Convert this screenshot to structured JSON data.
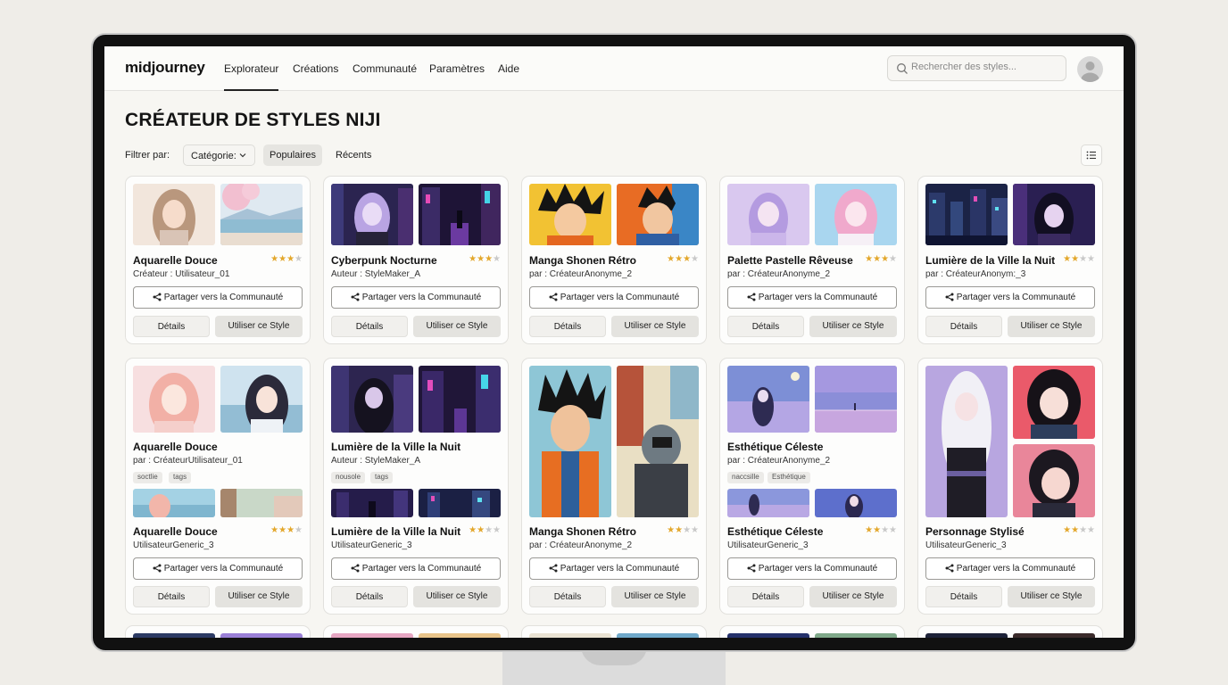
{
  "nav": {
    "logo": "midjourney",
    "items": [
      "Explorateur",
      "Créations",
      "Communauté",
      "Paramètres",
      "Aide"
    ],
    "search_placeholder": "Rechercher des styles..."
  },
  "page": {
    "title": "CRÉATEUR DE STYLES NIJI",
    "filter_label": "Filtrer par:",
    "category_label": "Catégorie:",
    "filters": [
      "Populaires",
      "Récents"
    ]
  },
  "buttons": {
    "share": "Partager vers la Communauté",
    "details": "Détails",
    "use": "Utiliser ce Style"
  },
  "row1": [
    {
      "title": "Aquarelle Douce",
      "author": "Créateur : Utilisateur_01",
      "rating": 3
    },
    {
      "title": "Cyberpunk Nocturne",
      "author": "Auteur : StyleMaker_A",
      "rating": 3
    },
    {
      "title": "Manga Shonen Rétro",
      "author": "par : CréateurAnonyme_2",
      "rating": 3
    },
    {
      "title": "Palette Pastelle Rêveuse",
      "author": "par : CréateurAnonyme_2",
      "rating": 3
    },
    {
      "title": "Lumière de la Ville la Nuit",
      "author": "par : CréateurAnonym:_3",
      "rating": 2
    }
  ],
  "row2": [
    {
      "title": "Aquarelle Douce",
      "author": "par : CréateurUtilisateur_01",
      "tags": [
        "soctlie",
        "tags"
      ],
      "title2": "Aquarelle Douce",
      "author2": "UtilisateurGeneric_3",
      "rating": 3
    },
    {
      "title": "Lumière de la Ville la Nuit",
      "author": "Auteur : StyleMaker_A",
      "tags": [
        "nousole",
        "tags"
      ],
      "title2": "Lumière de la Ville la Nuit",
      "author2": "UtilisateurGeneric_3",
      "rating": 2
    },
    {
      "title2": "Manga Shonen Rétro",
      "author2": "par : CréateurAnonyme_2",
      "rating": 2
    },
    {
      "title": "Esthétique Céleste",
      "author": "par : CréateurAnonyme_2",
      "tags": [
        "naccsille",
        "Esthétique"
      ],
      "title2": "Esthétique Céleste",
      "author2": "UtilisateurGeneric_3",
      "rating": 2
    },
    {
      "title2": "Personnage Stylisé",
      "author2": "UtilisateurGeneric_3",
      "rating": 2
    }
  ],
  "colors": {
    "accent_star": "#e3a72b",
    "star_off": "#c9c9c9",
    "text": "#1d1d1d"
  }
}
